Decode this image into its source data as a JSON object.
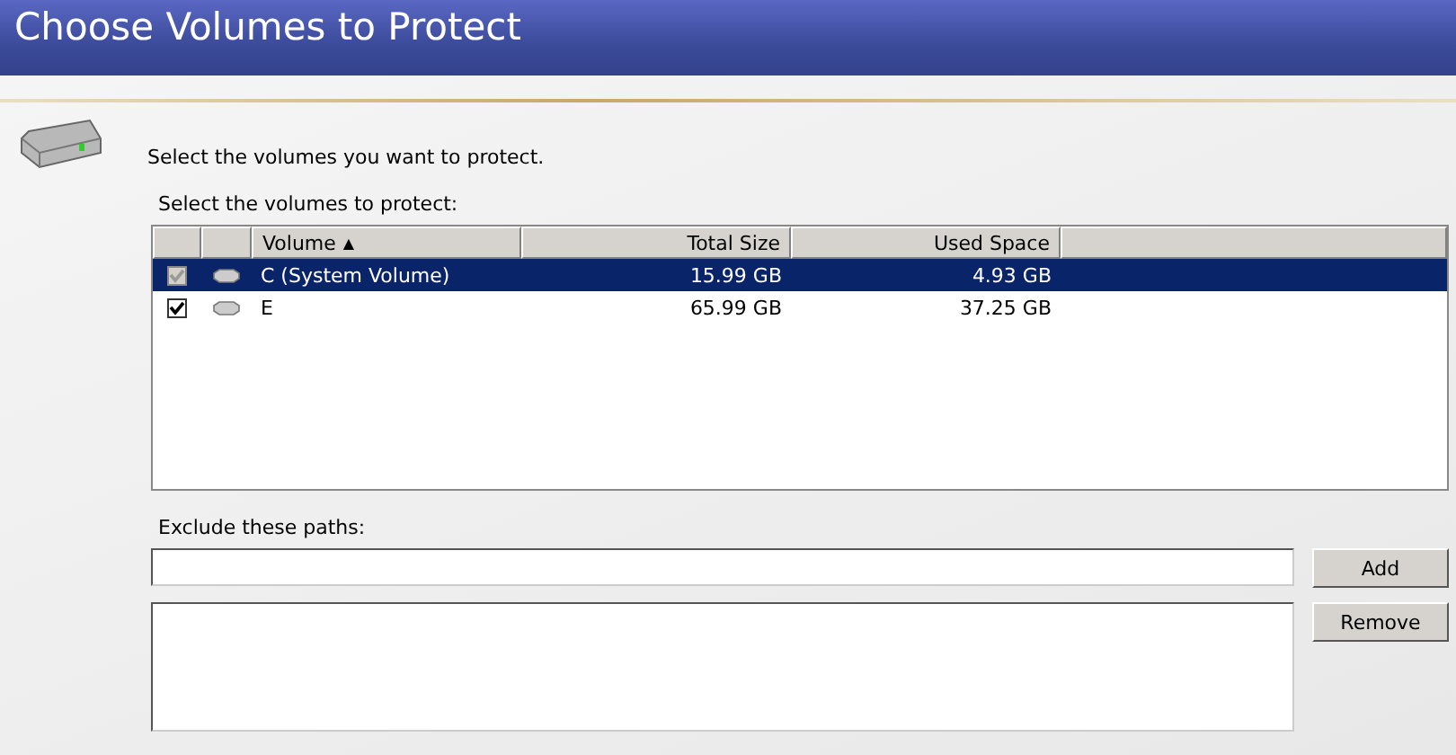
{
  "header": {
    "title": "Choose Volumes to Protect"
  },
  "intro": "Select the volumes you want to protect.",
  "volumes_label": "Select the volumes to protect:",
  "table": {
    "columns": [
      {
        "label": "Volume",
        "sort": "▲"
      },
      {
        "label": "Total Size"
      },
      {
        "label": "Used Space"
      }
    ],
    "rows": [
      {
        "checked": true,
        "disabled": true,
        "selected": true,
        "cells": [
          "C (System Volume)",
          "15.99 GB",
          "4.93 GB"
        ]
      },
      {
        "checked": true,
        "disabled": false,
        "selected": false,
        "cells": [
          "E",
          "65.99 GB",
          "37.25 GB"
        ]
      }
    ]
  },
  "exclude_label": "Exclude these paths:",
  "buttons": [
    "Add",
    "Remove"
  ]
}
